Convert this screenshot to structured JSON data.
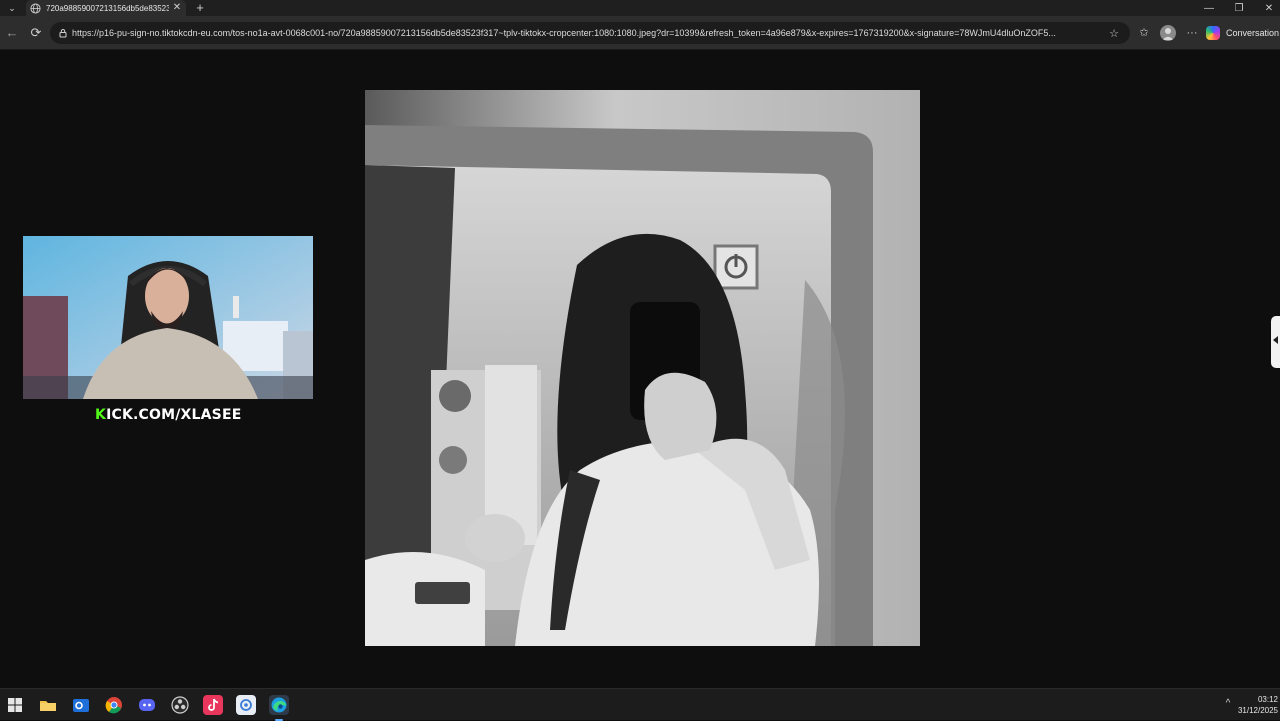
{
  "browser": {
    "tab": {
      "title": "720a98859007213156db5de83523",
      "close_glyph": "✕"
    },
    "new_tab_glyph": "+",
    "window_controls": {
      "minimize": "—",
      "restore": "❐",
      "close": "✕"
    },
    "address_bar": {
      "url": "https://p16-pu-sign-no.tiktokcdn-eu.com/tos-no1a-avt-0068c001-no/720a98859007213156db5de83523f317~tplv-tiktokx-cropcenter:1080:1080.jpeg?dr=10399&refresh_token=4a96e879&x-expires=1767319200&x-signature=78WJmU4dluOnZOF5..."
    },
    "toolbar": {
      "back_glyph": "←",
      "refresh_glyph": "⟳",
      "more_glyph": "···",
      "conversation_label": "Conversation"
    }
  },
  "content": {
    "image_kind": "black-and-white mirror selfie photo",
    "webcam_overlay": {
      "kick_letter": "K",
      "kick_rest": "ICK.COM/XLASEE"
    }
  },
  "taskbar": {
    "apps": [
      "start-icon",
      "file-explorer-icon",
      "outlook-icon",
      "chrome-icon",
      "discord-icon",
      "obs-icon",
      "tiktok-icon",
      "app-icon",
      "edge-icon"
    ],
    "tray_arrow": "^",
    "time": "03:12",
    "date": "31/12/2025"
  },
  "colors": {
    "kick_green": "#53fc18",
    "taskbar_accent": "#5aa7ff",
    "background": "#0e0e0e"
  }
}
